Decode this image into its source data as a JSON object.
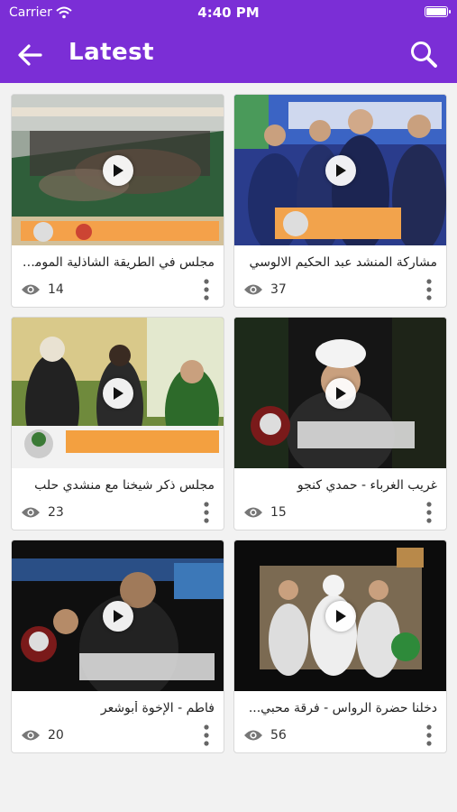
{
  "status_bar": {
    "carrier": "Carrier",
    "time": "4:40 PM"
  },
  "app_bar": {
    "title": "Latest",
    "back_icon": "arrow-left-icon",
    "search_icon": "search-icon",
    "background": "#7b2ed6"
  },
  "videos": [
    {
      "title": "مجلس في الطريقة الشاذلية المومنية",
      "views": "14"
    },
    {
      "title": "مشاركة المنشد عبد الحكيم الالوسي",
      "views": "37"
    },
    {
      "title": "مجلس ذكر شيخنا مع منشدي حلب",
      "views": "23"
    },
    {
      "title": "غريب الغرباء - حمدي كنجو",
      "views": "15"
    },
    {
      "title": "فاطم - الإخوة أبوشعر",
      "views": "20"
    },
    {
      "title": "دخلنا حضرة الرواس - فرقة محبي...",
      "views": "56"
    }
  ]
}
